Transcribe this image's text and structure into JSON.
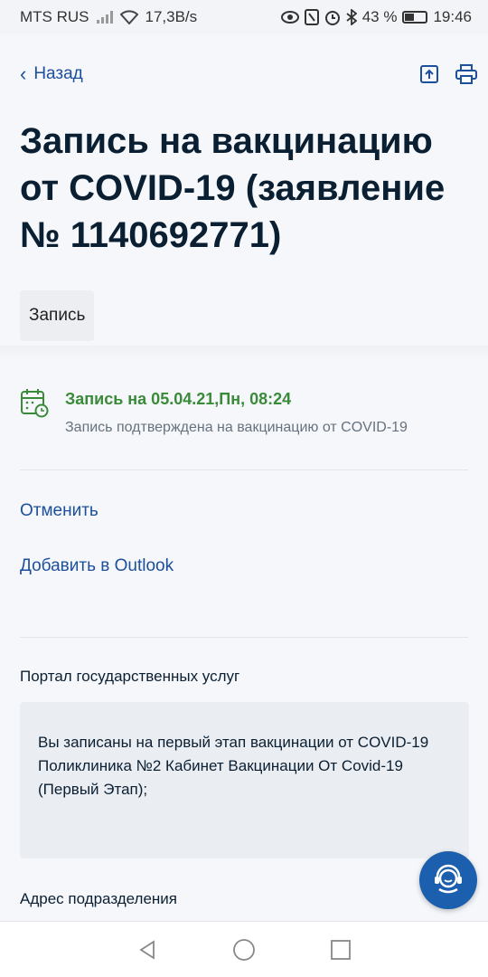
{
  "statusbar": {
    "carrier": "MTS RUS",
    "speed": "17,3В/s",
    "battery": "43 %",
    "battery_level": 0.43,
    "time": "19:46"
  },
  "nav": {
    "back_label": "Назад"
  },
  "page": {
    "title": "Запись на вакцинацию от COVID-19 (заявление № 1140692771)",
    "tag": "Запись"
  },
  "event": {
    "title": "Запись на 05.04.21,Пн, 08:24",
    "subtitle": "Запись подтверждена на вакцинацию от COVID-19"
  },
  "actions": {
    "cancel": "Отменить",
    "add_outlook": "Добавить в Outlook"
  },
  "details": {
    "source_label": "Портал государственных услуг",
    "message_line1": "Вы записаны на первый этап вакцинации от COVID-19",
    "message_line2": "Поликлиника №2 Кабинет Вакцинации От Covid-19 (Первый Этап);",
    "address_label": "Адрес подразделения"
  },
  "colors": {
    "link": "#1c4f9c",
    "success": "#3a8a3a",
    "support": "#1c5fae"
  }
}
